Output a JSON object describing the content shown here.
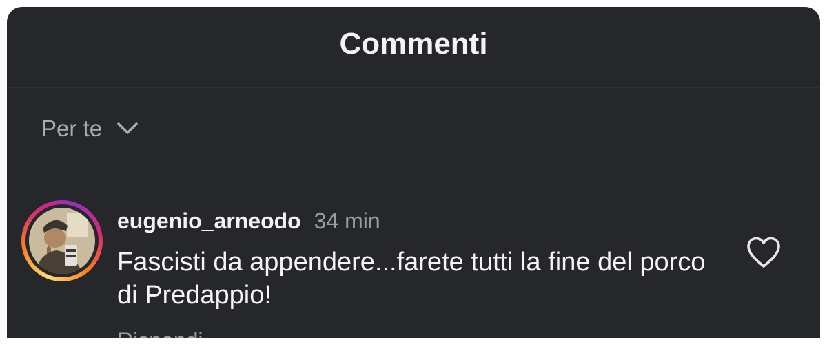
{
  "header": {
    "title": "Commenti"
  },
  "sort": {
    "label": "Per te"
  },
  "comment": {
    "username": "eugenio_arneodo",
    "time": "34 min",
    "text": "Fascisti da appendere...farete tutti la fine del porco di Predappio!",
    "reply_label": "Rispondi"
  },
  "icons": {
    "sort": "chevron-down-icon",
    "like": "heart-outline-icon"
  },
  "colors": {
    "background": "#25272b",
    "text": "#f5f5f5",
    "muted": "#9a9da3"
  }
}
